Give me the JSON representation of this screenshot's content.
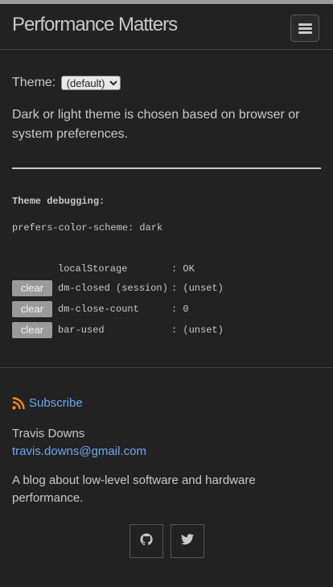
{
  "header": {
    "title": "Performance Matters"
  },
  "theme": {
    "label": "Theme:",
    "selected": "(default)"
  },
  "description": "Dark or light theme is chosen based on browser or system preferences.",
  "debug": {
    "title": "Theme debugging:",
    "prefers": "prefers-color-scheme: dark",
    "rows": [
      {
        "button": "",
        "key": "localStorage",
        "value": ": OK"
      },
      {
        "button": "clear",
        "key": "dm-closed (session)",
        "value": ": (unset)"
      },
      {
        "button": "clear",
        "key": "dm-close-count",
        "value": ": 0"
      },
      {
        "button": "clear",
        "key": "bar-used",
        "value": ": (unset)"
      }
    ]
  },
  "footer": {
    "subscribe": "Subscribe",
    "author": "Travis Downs",
    "email": "travis.downs@gmail.com",
    "blurb": "A blog about low-level software and hardware performance."
  },
  "icons": {
    "menu": "hamburger-icon",
    "rss": "rss-icon",
    "github": "github-icon",
    "twitter": "twitter-icon"
  },
  "colors": {
    "background": "#222222",
    "text": "#c8c8c8",
    "link": "#6fa8f0",
    "rss": "#f08a24"
  }
}
